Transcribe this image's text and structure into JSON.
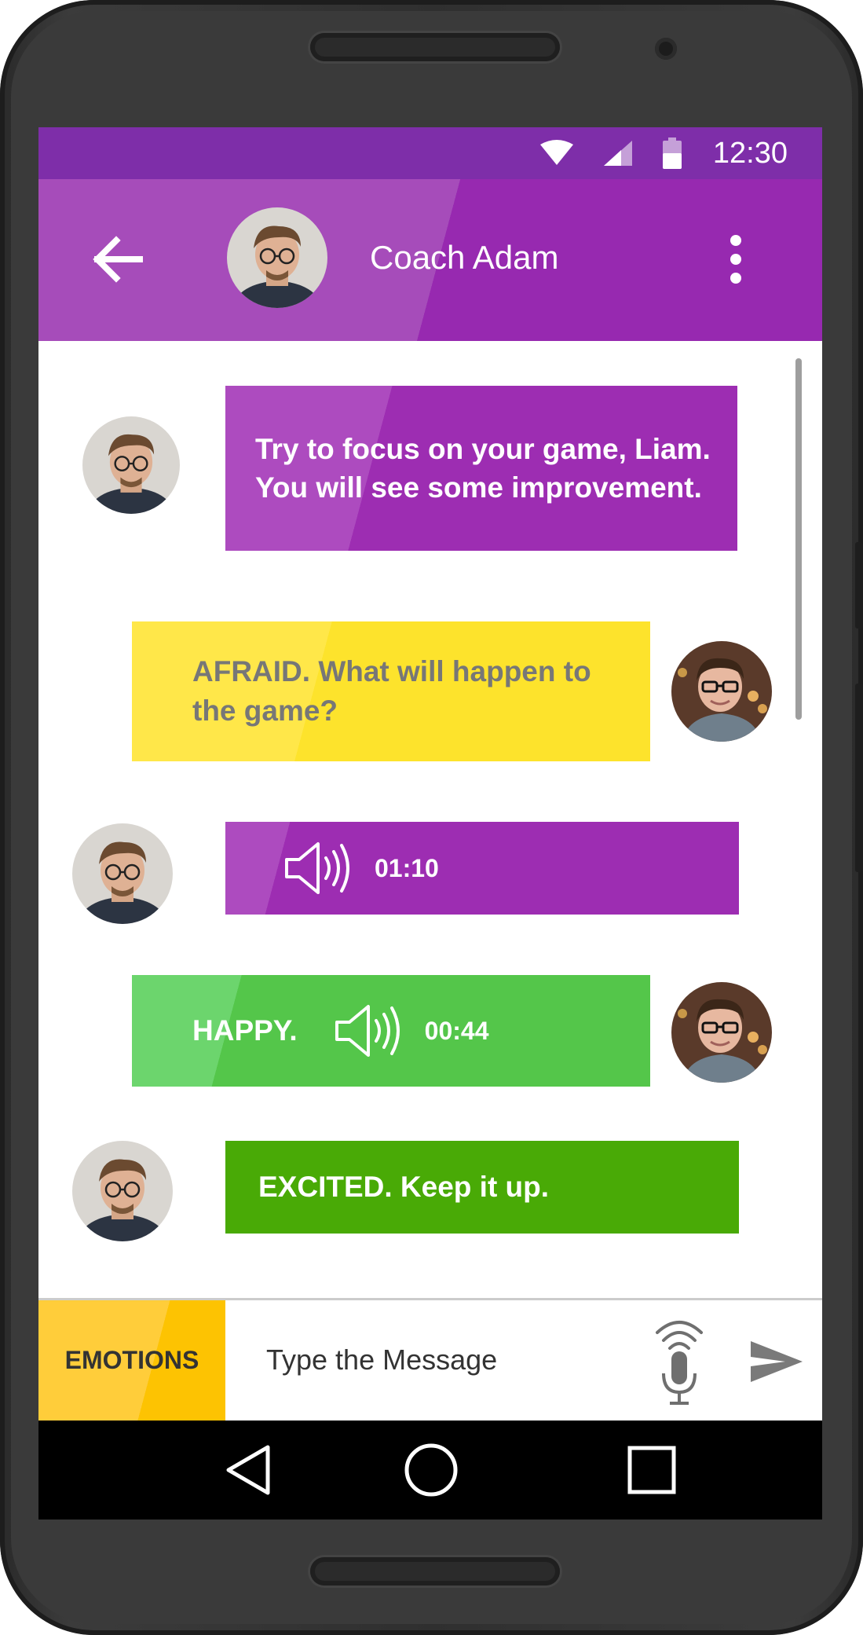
{
  "status_bar": {
    "time": "12:30"
  },
  "header": {
    "contact_name": "Coach Adam"
  },
  "messages": [
    {
      "sender": "coach",
      "text": "Try to focus on your game, Liam. You will see some improvement."
    },
    {
      "sender": "user",
      "text": "AFRAID. What will happen to the game?"
    },
    {
      "sender": "coach",
      "type": "voice",
      "duration": "01:10"
    },
    {
      "sender": "user",
      "type": "voice",
      "emotion": "HAPPY.",
      "duration": "00:44"
    },
    {
      "sender": "coach",
      "text": "EXCITED. Keep it up."
    }
  ],
  "input": {
    "emotions_label": "EMOTIONS",
    "placeholder": "Type the Message"
  },
  "colors": {
    "primary": "#9d2db2",
    "status_bar": "#7e2ea9",
    "yellow_bubble": "#fde32c",
    "green_bubble": "#54c64a",
    "dark_green_bubble": "#49aa06",
    "emotions_button": "#fdc302"
  },
  "icons": {
    "back": "arrow-left-icon",
    "menu": "more-vert-icon",
    "voice": "speaker-icon",
    "mic": "mic-icon",
    "send": "send-icon"
  }
}
